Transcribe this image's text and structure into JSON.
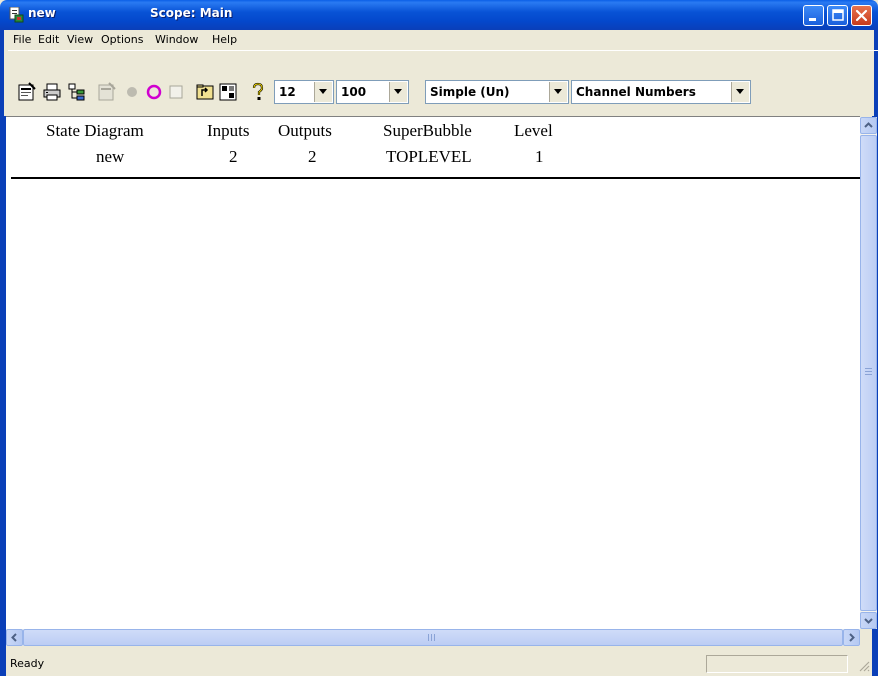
{
  "window": {
    "app_name": "new",
    "title": "Scope: Main",
    "controls": [
      "minimize-icon",
      "maximize-icon",
      "close-icon"
    ],
    "accent_color": "#0a3fb8"
  },
  "menu": [
    "File",
    "Edit",
    "View",
    "Options",
    "Window",
    "Help"
  ],
  "toolbar": {
    "buttons": [
      {
        "icon": "properties-icon",
        "enabled": true
      },
      {
        "icon": "print-icon",
        "enabled": true
      },
      {
        "icon": "hierarchy-icon",
        "enabled": true
      },
      {
        "icon": "properties-disabled-icon",
        "enabled": false
      },
      {
        "icon": "state-dot-icon",
        "enabled": false
      },
      {
        "icon": "state-circle-icon",
        "enabled": true
      },
      {
        "icon": "rectangle-icon",
        "enabled": false
      },
      {
        "icon": "up-folder-icon",
        "enabled": true
      },
      {
        "icon": "expand-icon",
        "enabled": true
      },
      {
        "icon": "help-icon",
        "enabled": true
      }
    ],
    "font_size": "12",
    "zoom": "100",
    "mode": "Simple (Un)",
    "display": "Channel Numbers"
  },
  "table": {
    "headers": [
      "State Diagram",
      "Inputs",
      "Outputs",
      "SuperBubble",
      "Level"
    ],
    "row": [
      "new",
      "2",
      "2",
      "TOPLEVEL",
      "1"
    ]
  },
  "status": {
    "text": "Ready"
  }
}
